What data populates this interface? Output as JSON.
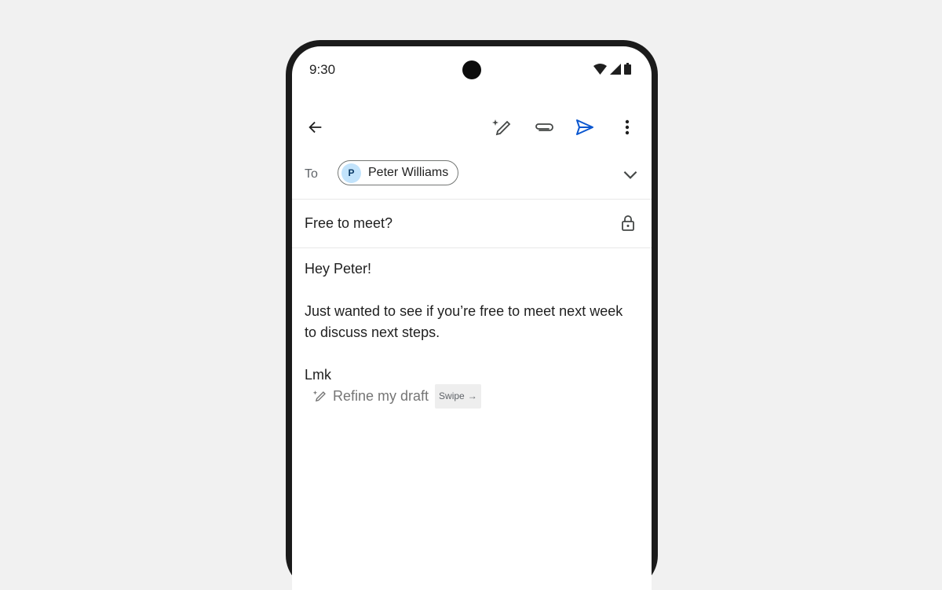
{
  "status_bar": {
    "time": "9:30",
    "icons": [
      "wifi-icon",
      "cell-signal-icon",
      "battery-icon"
    ]
  },
  "toolbar": {
    "back_icon": "arrow-left-icon",
    "actions": [
      {
        "name": "help-me-write",
        "icon": "pen-sparkle-icon"
      },
      {
        "name": "attach",
        "icon": "paperclip-icon"
      },
      {
        "name": "send",
        "icon": "send-icon"
      },
      {
        "name": "more-options",
        "icon": "more-vertical-icon"
      }
    ]
  },
  "compose": {
    "to_label": "To",
    "recipient": {
      "initial": "P",
      "name": "Peter Williams"
    },
    "subject": "Free to meet?",
    "body": {
      "greeting": "Hey Peter!",
      "line1": "Just wanted to see if you’re free to meet next week",
      "line2": "to discuss next steps.",
      "signoff": "Lmk"
    },
    "refine": {
      "label": "Refine my draft",
      "hint": "Swipe",
      "hint_arrow": "→"
    }
  },
  "colors": {
    "accent": "#0b57d0",
    "avatar_bg": "#c2e3fb",
    "text": "#1f1f1f",
    "muted": "#757575",
    "background": "#f1f1f1",
    "frame": "#1b1b1b"
  }
}
